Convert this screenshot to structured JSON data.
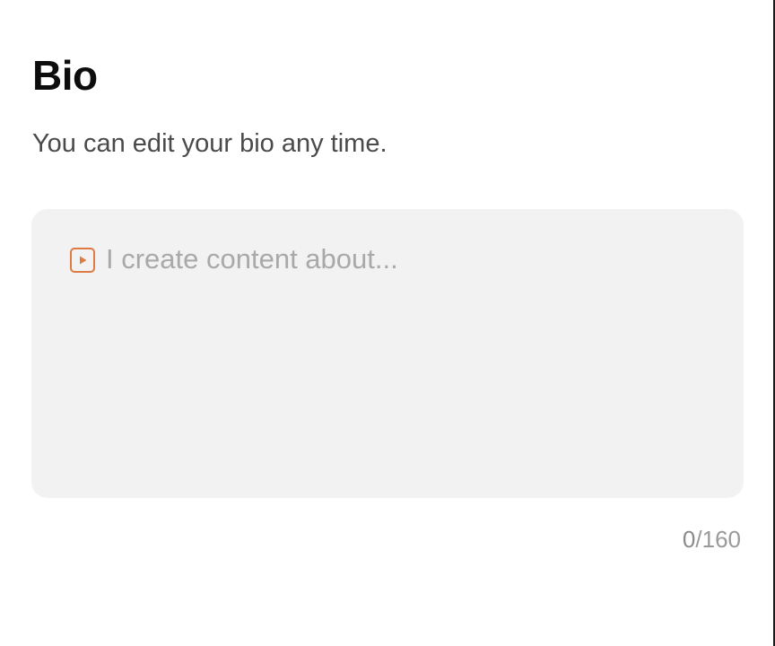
{
  "header": {
    "title": "Bio",
    "subtitle": "You can edit your bio any time."
  },
  "bio_field": {
    "value": "",
    "placeholder": "I create content about...",
    "icon": "play-square-icon",
    "icon_color": "#e07a45",
    "background": "#f2f2f2"
  },
  "counter": {
    "current": "0",
    "separator": "/",
    "max": "160"
  }
}
